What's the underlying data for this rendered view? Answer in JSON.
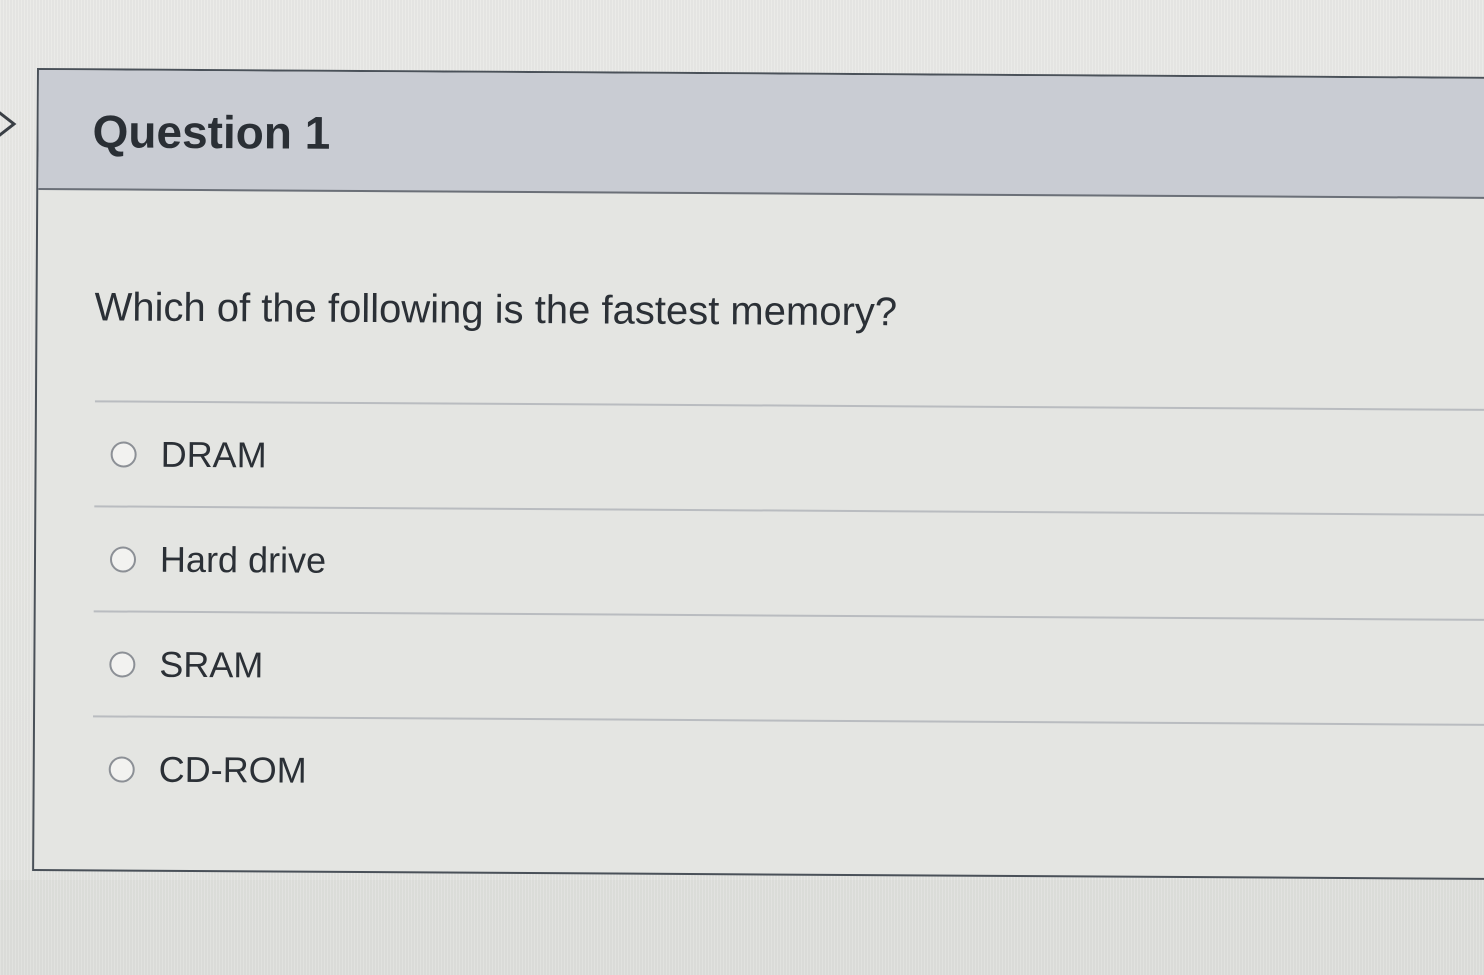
{
  "question": {
    "title": "Question 1",
    "prompt": "Which of the following is the fastest memory?",
    "answers": [
      {
        "label": "DRAM"
      },
      {
        "label": "Hard drive"
      },
      {
        "label": "SRAM"
      },
      {
        "label": "CD-ROM"
      }
    ]
  },
  "icons": {
    "expand": "chevron-right-icon",
    "radio": "radio-unselected"
  },
  "colors": {
    "header_bg": "#c9ccd3",
    "card_border": "#4a5159",
    "text": "#2b3036"
  }
}
